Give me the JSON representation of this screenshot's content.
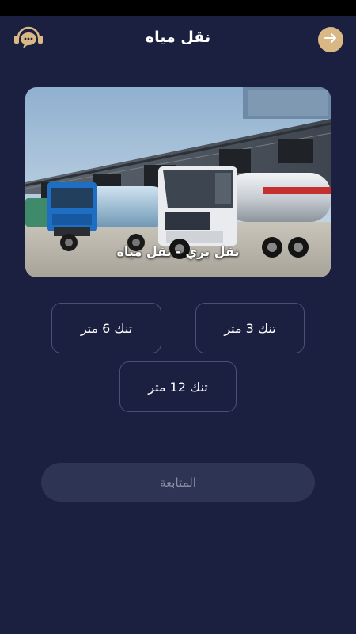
{
  "header": {
    "title": "نقل مياه",
    "support_icon": "chat-support-icon",
    "forward_icon": "arrow-right-icon"
  },
  "hero": {
    "caption": "نقل بري - نقل مياه"
  },
  "options": [
    {
      "label": "تنك 3 متر"
    },
    {
      "label": "تنك 6 متر"
    },
    {
      "label": "تنك 12 متر"
    }
  ],
  "continue": {
    "label": "المتابعة"
  },
  "colors": {
    "background": "#1b2040",
    "accent": "#d9b886",
    "border": "#4a5075",
    "button_disabled": "#2e3453"
  }
}
